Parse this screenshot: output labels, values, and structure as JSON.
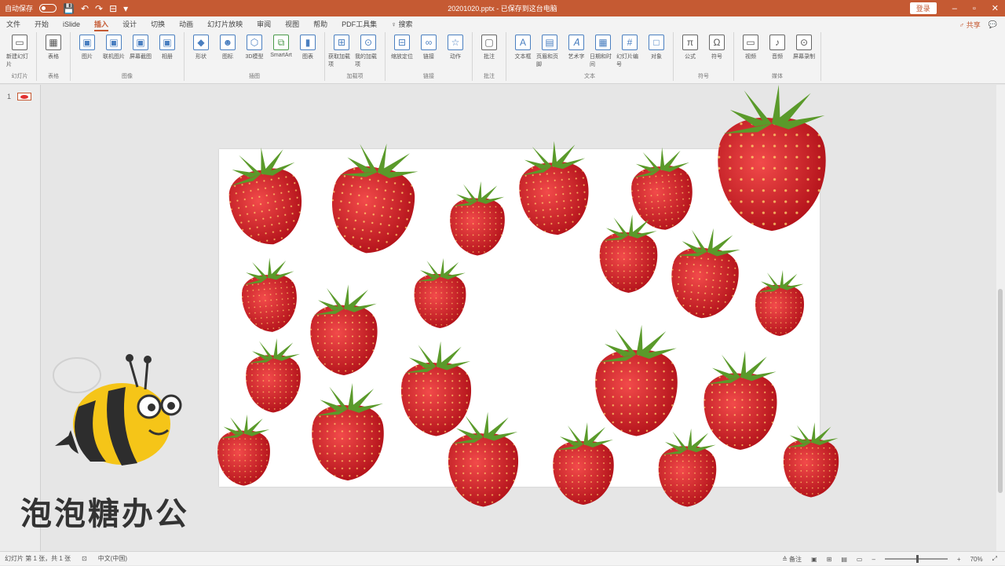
{
  "titlebar": {
    "autosave": "自动保存",
    "filename": "20201020.pptx - 已保存到这台电脑",
    "login": "登录",
    "controls": [
      "–",
      "▫",
      "✕"
    ]
  },
  "quick": [
    "💾",
    "↶",
    "↷",
    "⊟",
    "▾"
  ],
  "tabs": [
    {
      "label": "文件"
    },
    {
      "label": "开始"
    },
    {
      "label": "iSlide"
    },
    {
      "label": "插入",
      "active": true
    },
    {
      "label": "设计"
    },
    {
      "label": "切换"
    },
    {
      "label": "动画"
    },
    {
      "label": "幻灯片放映"
    },
    {
      "label": "审阅"
    },
    {
      "label": "视图"
    },
    {
      "label": "帮助"
    },
    {
      "label": "PDF工具集"
    },
    {
      "label": "♀ 搜索"
    }
  ],
  "menu_right": {
    "share": "♂ 共享",
    "comment": "💬"
  },
  "ribbon": {
    "groups": [
      {
        "label": "幻灯片",
        "buttons": [
          {
            "label": "新建幻灯片",
            "glyph": "▭",
            "cls": "p"
          }
        ]
      },
      {
        "label": "表格",
        "buttons": [
          {
            "label": "表格",
            "glyph": "▦",
            "cls": "p"
          }
        ]
      },
      {
        "label": "图像",
        "buttons": [
          {
            "label": "图片",
            "glyph": "▣"
          },
          {
            "label": "联机图片",
            "glyph": "▣"
          },
          {
            "label": "屏幕截图",
            "glyph": "▣"
          },
          {
            "label": "相册",
            "glyph": "▣"
          }
        ]
      },
      {
        "label": "插图",
        "buttons": [
          {
            "label": "形状",
            "glyph": "◆"
          },
          {
            "label": "图标",
            "glyph": "☻"
          },
          {
            "label": "3D模型",
            "glyph": "⬡"
          },
          {
            "label": "SmartArt",
            "glyph": "⧉",
            "cls": "g"
          },
          {
            "label": "图表",
            "glyph": "▮"
          }
        ]
      },
      {
        "label": "加载项",
        "buttons": [
          {
            "label": "获取加载项",
            "glyph": "⊞"
          },
          {
            "label": "我的加载项",
            "glyph": "⊙"
          }
        ]
      },
      {
        "label": "链接",
        "buttons": [
          {
            "label": "缩放定位",
            "glyph": "⊟"
          },
          {
            "label": "链接",
            "glyph": "∞"
          },
          {
            "label": "动作",
            "glyph": "☆"
          }
        ]
      },
      {
        "label": "批注",
        "buttons": [
          {
            "label": "批注",
            "glyph": "▢",
            "cls": "p"
          }
        ]
      },
      {
        "label": "文本",
        "buttons": [
          {
            "label": "文本框",
            "glyph": "A"
          },
          {
            "label": "页眉和页脚",
            "glyph": "▤"
          },
          {
            "label": "艺术字",
            "glyph": "𝐴"
          },
          {
            "label": "日期和时间",
            "glyph": "▦"
          },
          {
            "label": "幻灯片编号",
            "glyph": "#"
          },
          {
            "label": "对象",
            "glyph": "□"
          }
        ]
      },
      {
        "label": "符号",
        "buttons": [
          {
            "label": "公式",
            "glyph": "π",
            "cls": "p"
          },
          {
            "label": "符号",
            "glyph": "Ω",
            "cls": "p"
          }
        ]
      },
      {
        "label": "媒体",
        "buttons": [
          {
            "label": "视频",
            "glyph": "▭",
            "cls": "p"
          },
          {
            "label": "音频",
            "glyph": "♪",
            "cls": "p"
          },
          {
            "label": "屏幕录制",
            "glyph": "⊙",
            "cls": "p"
          }
        ]
      }
    ]
  },
  "pane": {
    "slide_number": "1"
  },
  "watermark": {
    "brand": "泡泡糖办公"
  },
  "status": {
    "slide": "幻灯片 第 1 张，共 1 张",
    "language": "中文(中国)",
    "notes": "≙ 备注",
    "zoom": "70%"
  },
  "colors": {
    "accent": "#c55a33",
    "strawberry": "#d8232a",
    "leaf": "#5a9a2a"
  }
}
